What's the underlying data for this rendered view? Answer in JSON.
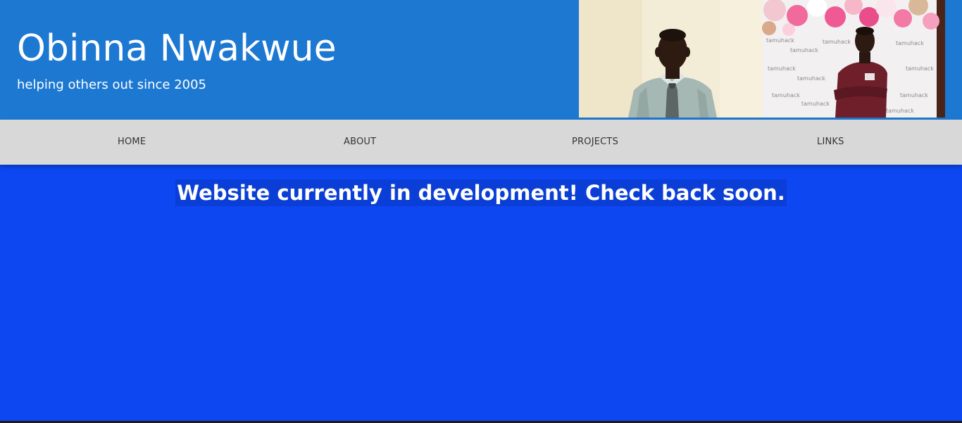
{
  "header": {
    "title": "Obinna Nwakwue",
    "tagline": "helping others out since 2005",
    "photos": [
      {
        "subject": "portrait-shirt-tie"
      },
      {
        "subject": "tamuhack-backdrop-balloons",
        "backdrop_text": "tamuhack"
      }
    ]
  },
  "nav": {
    "items": [
      {
        "label": "HOME"
      },
      {
        "label": "ABOUT"
      },
      {
        "label": "PROJECTS"
      },
      {
        "label": "LINKS"
      }
    ]
  },
  "main": {
    "notice": "Website currently in development! Check back soon."
  },
  "colors": {
    "header_bg": "#1d78d2",
    "nav_bg": "#d8d8d8",
    "page_bg": "#0d47f2",
    "notice_highlight": "#0b3ed6",
    "text_light": "#ffffff",
    "nav_text": "#333333"
  }
}
